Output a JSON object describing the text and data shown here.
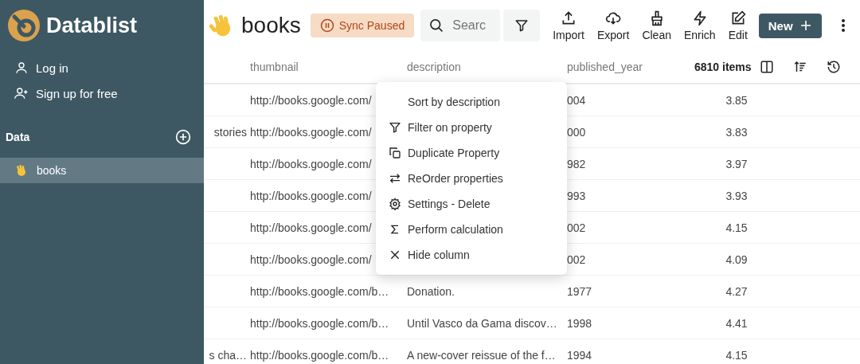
{
  "sidebar": {
    "brand": "Datablist",
    "auth_links": [
      {
        "label": "Log in",
        "kind": "login"
      },
      {
        "label": "Sign up for free",
        "kind": "signup"
      }
    ],
    "section_title": "Data",
    "collections": [
      {
        "label": "books",
        "selected": true
      }
    ]
  },
  "header": {
    "title": "books",
    "status_badge": "Sync Paused",
    "search": {
      "placeholder": "Searc"
    },
    "actions": [
      {
        "label": "Import",
        "kind": "import"
      },
      {
        "label": "Export",
        "kind": "export"
      },
      {
        "label": "Clean",
        "kind": "clean"
      },
      {
        "label": "Enrich",
        "kind": "enrich"
      },
      {
        "label": "Edit",
        "kind": "edit"
      }
    ],
    "new_button": "New"
  },
  "table": {
    "columns": [
      "thumbnail",
      "description",
      "published_year"
    ],
    "item_count": "6810 items",
    "rows": [
      {
        "thumbnail": "http://books.google.com/",
        "published_year": "004",
        "column_5": "3.85"
      },
      {
        "column_1": "stories",
        "thumbnail": "http://books.google.com/",
        "published_year": "000",
        "column_5": "3.83"
      },
      {
        "thumbnail": "http://books.google.com/",
        "published_year": "982",
        "column_5": "3.97"
      },
      {
        "thumbnail": "http://books.google.com/",
        "published_year": "993",
        "column_5": "3.93"
      },
      {
        "thumbnail": "http://books.google.com/",
        "published_year": "002",
        "column_5": "4.15"
      },
      {
        "thumbnail": "http://books.google.com/",
        "published_year": "002",
        "column_5": "4.09"
      },
      {
        "thumbnail": "http://books.google.com/b…",
        "description": "Donation.",
        "published_year": "1977",
        "column_5": "4.27"
      },
      {
        "thumbnail": "http://books.google.com/b…",
        "description": "Until Vasco da Gama discov…",
        "published_year": "1998",
        "column_5": "4.41"
      },
      {
        "column_1": "s cha…",
        "thumbnail": "http://books.google.com/b…",
        "description": "A new-cover reissue of the f…",
        "published_year": "1994",
        "column_5": "4.15"
      }
    ]
  },
  "context_menu": {
    "items": [
      {
        "label": "Sort by description",
        "kind": "sort"
      },
      {
        "label": "Filter on property",
        "kind": "filter"
      },
      {
        "label": "Duplicate Property",
        "kind": "duplicate"
      },
      {
        "label": "ReOrder properties",
        "kind": "reorder"
      },
      {
        "label": "Settings - Delete",
        "kind": "settings"
      },
      {
        "label": "Perform calculation",
        "kind": "calculate"
      },
      {
        "label": "Hide column",
        "kind": "hide"
      }
    ]
  }
}
